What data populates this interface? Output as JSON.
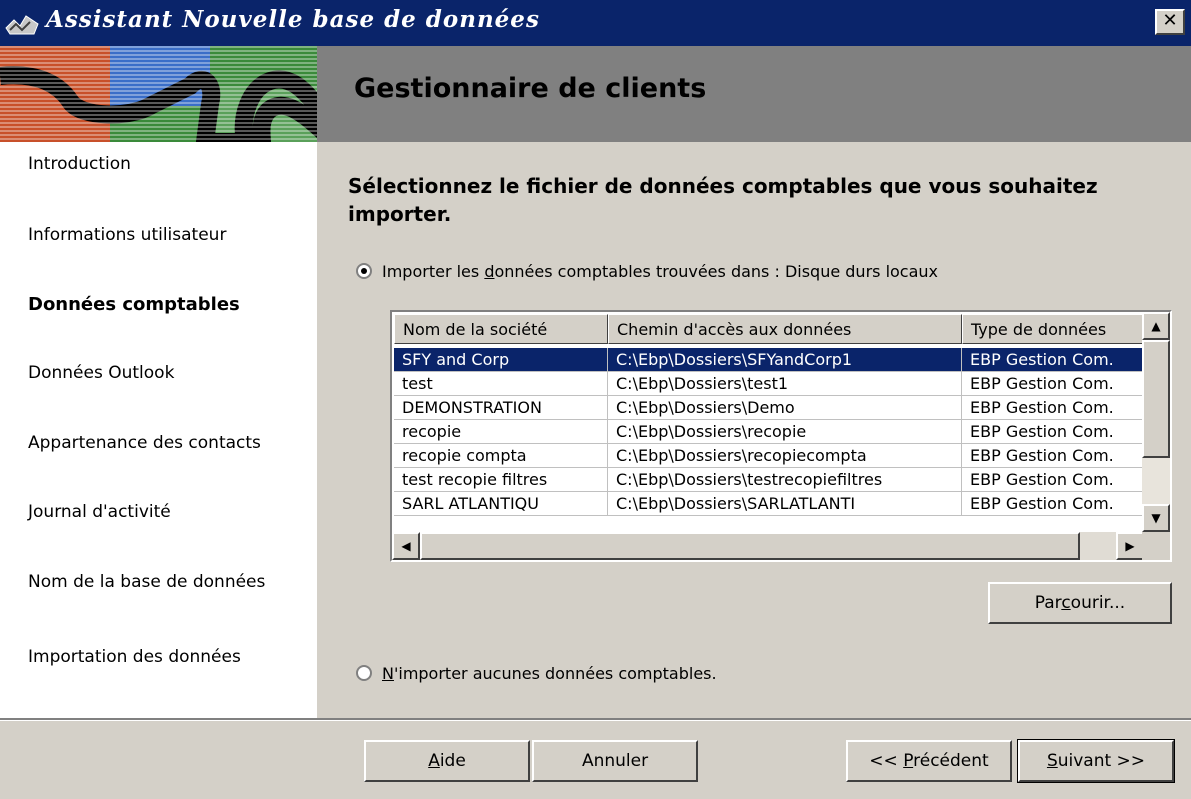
{
  "window": {
    "title": "Assistant Nouvelle base de données",
    "close_glyph": "✕",
    "icon": "wizard-icon"
  },
  "banner": {
    "title": "Gestionnaire de clients"
  },
  "steps": [
    {
      "label": "Introduction",
      "active": false
    },
    {
      "label": "Informations utilisateur",
      "active": false
    },
    {
      "label": "Données comptables",
      "active": true
    },
    {
      "label": "Données Outlook",
      "active": false
    },
    {
      "label": "Appartenance des contacts",
      "active": false
    },
    {
      "label": "Journal d'activité",
      "active": false
    },
    {
      "label": "Nom de la base de données",
      "active": false
    },
    {
      "label": "Importation des données",
      "active": false
    }
  ],
  "main": {
    "heading": "Sélectionnez le fichier de données comptables que vous souhaitez importer.",
    "option_import": {
      "pre": "Importer les ",
      "mnemonic": "d",
      "post": "onnées comptables trouvées dans : Disque durs locaux",
      "checked": true
    },
    "option_none": {
      "mnemonic": "N",
      "post": "'importer aucunes données comptables.",
      "checked": false
    }
  },
  "table": {
    "columns": [
      "Nom de la société",
      "Chemin d'accès aux données",
      "Type de données"
    ],
    "rows": [
      [
        "SFY and Corp",
        "C:\\Ebp\\Dossiers\\SFYandCorp1",
        "EBP Gestion Com."
      ],
      [
        "test",
        "C:\\Ebp\\Dossiers\\test1",
        "EBP Gestion Com."
      ],
      [
        "DEMONSTRATION",
        "C:\\Ebp\\Dossiers\\Demo",
        "EBP Gestion Com."
      ],
      [
        "recopie",
        "C:\\Ebp\\Dossiers\\recopie",
        "EBP Gestion Com."
      ],
      [
        "recopie compta",
        "C:\\Ebp\\Dossiers\\recopiecompta",
        "EBP Gestion Com."
      ],
      [
        "test recopie filtres",
        "C:\\Ebp\\Dossiers\\testrecopiefiltres",
        "EBP Gestion Com."
      ],
      [
        "SARL ATLANTIQU",
        "C:\\Ebp\\Dossiers\\SARLATLANTI",
        "EBP Gestion Com."
      ]
    ],
    "selected_row": 0
  },
  "buttons": {
    "browse": {
      "pre": "Par",
      "mnemonic": "c",
      "post": "ourir..."
    },
    "help": {
      "pre": "",
      "mnemonic": "A",
      "post": "ide"
    },
    "cancel": {
      "label": "Annuler"
    },
    "previous": {
      "pre": "<< ",
      "mnemonic": "P",
      "post": "récédent"
    },
    "next": {
      "pre": "",
      "mnemonic": "S",
      "post": "uivant >>"
    }
  },
  "colors": {
    "titlebar": "#0a246a",
    "selection": "#0a246a",
    "banner": "#808080",
    "face": "#d4d0c8"
  }
}
